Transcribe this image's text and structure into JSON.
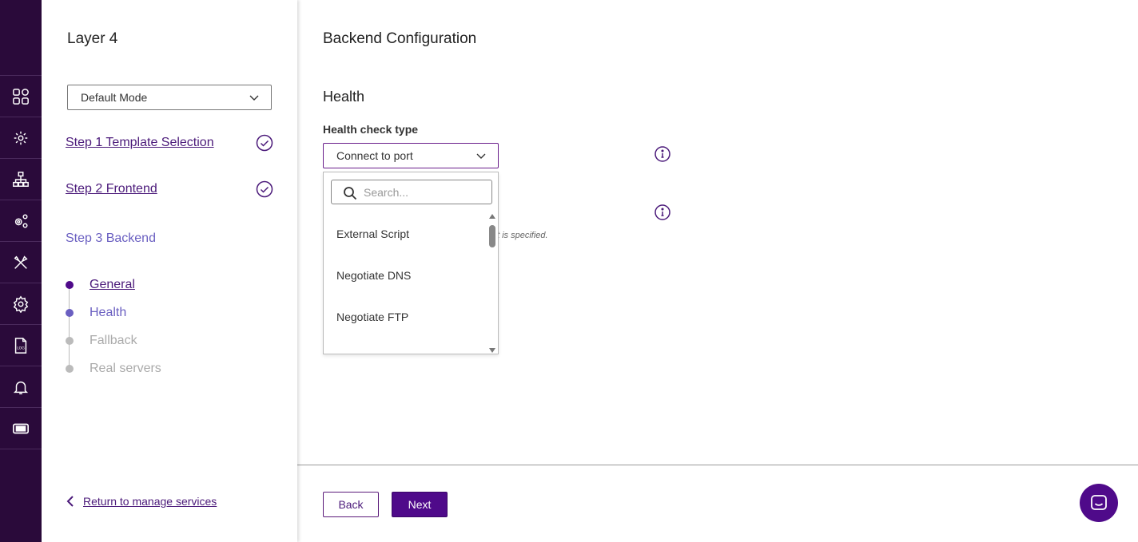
{
  "rail": {
    "icons": [
      "grid-icon",
      "service-gear-icon",
      "network-icon",
      "cogs-icon",
      "tools-icon",
      "settings-icon",
      "log-file-icon",
      "bell-icon",
      "ticket-icon"
    ],
    "log_label": "LOG"
  },
  "wizard": {
    "title": "Layer 4",
    "mode": "Default Mode",
    "steps": [
      {
        "label": "Step 1 Template Selection",
        "done": true
      },
      {
        "label": "Step 2 Frontend",
        "done": true
      },
      {
        "label": "Step 3 Backend",
        "done": false
      }
    ],
    "substeps": [
      {
        "label": "General",
        "state": "done"
      },
      {
        "label": "Health",
        "state": "current"
      },
      {
        "label": "Fallback",
        "state": "pending"
      },
      {
        "label": "Real servers",
        "state": "pending"
      }
    ],
    "return_label": "Return to manage services"
  },
  "main": {
    "title": "Backend Configuration",
    "section": "Health",
    "health_check_label": "Health check type",
    "health_check_value": "Connect to port",
    "hint_fragment": "t is specified.",
    "dropdown": {
      "search_placeholder": "Search...",
      "options": [
        "External Script",
        "Negotiate DNS",
        "Negotiate FTP"
      ]
    },
    "back_label": "Back",
    "next_label": "Next"
  },
  "colors": {
    "rail_bg": "#2a0a3a",
    "accent": "#4f0a8a",
    "link": "#4b1a7a",
    "active_step": "#6a5fc1"
  }
}
